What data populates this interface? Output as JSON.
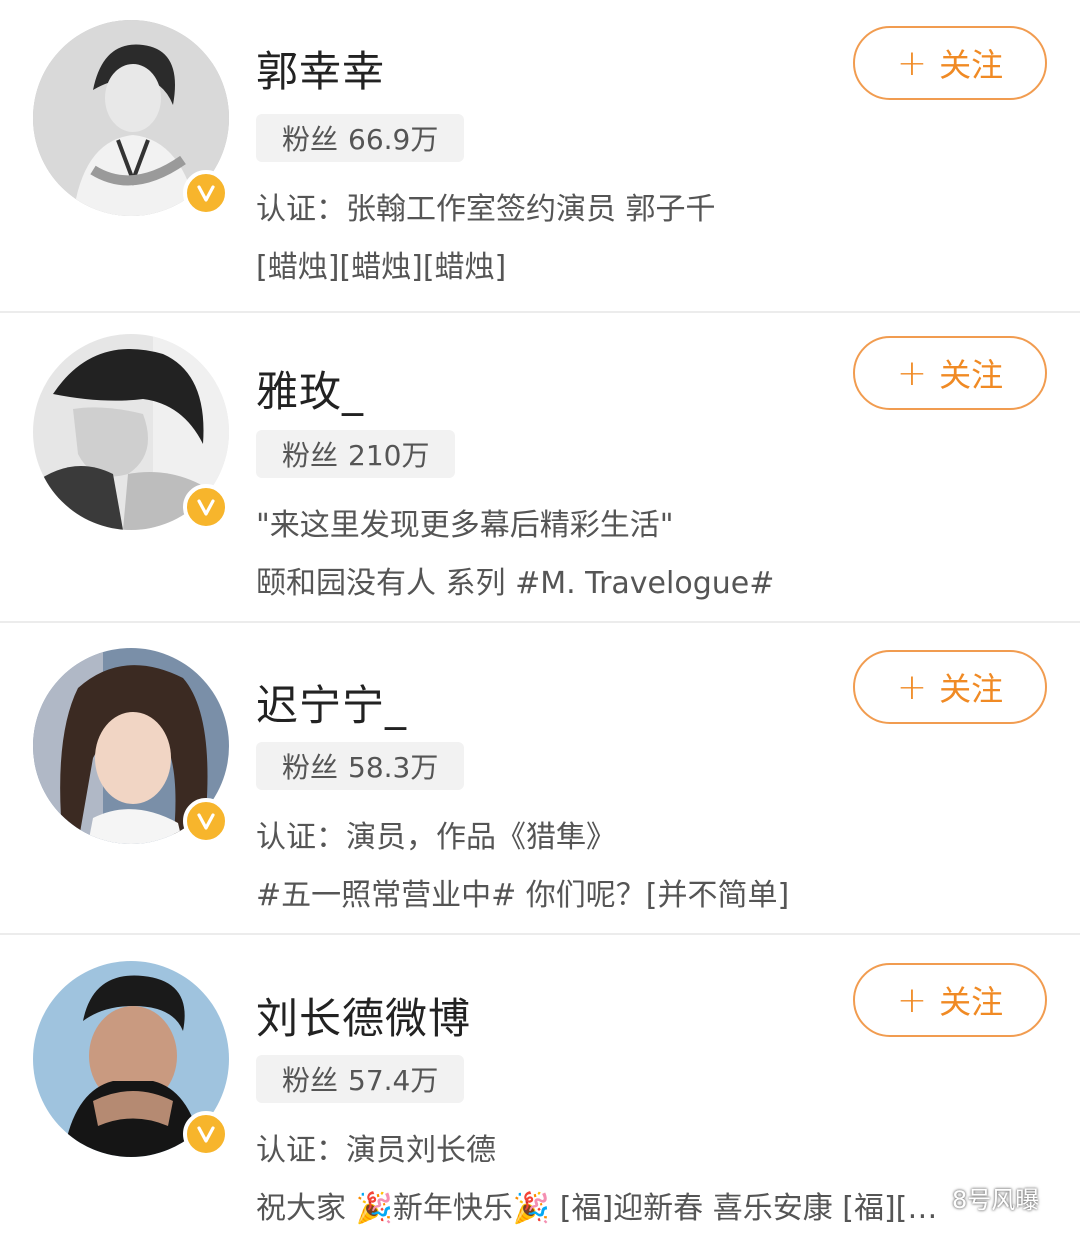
{
  "users": [
    {
      "name": "郭幸幸",
      "fans_label": "粉丝",
      "fans_count": "66.9万",
      "line1": "认证：张翰工作室签约演员 郭子千",
      "line2": "[蜡烛][蜡烛][蜡烛]",
      "follow_label": "关注",
      "avatar_icon": "user-avatar-photo",
      "badge_icon": "verified-v-icon"
    },
    {
      "name": "雅玫_",
      "fans_label": "粉丝",
      "fans_count": "210万",
      "line1": "\"来这里发现更多幕后精彩生活\"",
      "line2": "颐和园没有人 系列 #M. Travelogue#",
      "follow_label": "关注",
      "avatar_icon": "user-avatar-photo",
      "badge_icon": "verified-v-icon"
    },
    {
      "name": "迟宁宁_",
      "fans_label": "粉丝",
      "fans_count": "58.3万",
      "line1": "认证：演员，作品《猎隼》",
      "line2": "#五一照常营业中# 你们呢？[并不简单]",
      "follow_label": "关注",
      "avatar_icon": "user-avatar-photo",
      "badge_icon": "verified-v-icon"
    },
    {
      "name": "刘长德微博",
      "fans_label": "粉丝",
      "fans_count": "57.4万",
      "line1": "认证：演员刘长德",
      "line2": "祝大家 🎉新年快乐🎉 [福]迎新春 喜乐安康 [福][…",
      "follow_label": "关注",
      "avatar_icon": "user-avatar-photo",
      "badge_icon": "verified-v-icon"
    }
  ],
  "watermark": "8号风曝",
  "colors": {
    "accent": "#f08a24",
    "verified": "#f7b52c"
  }
}
